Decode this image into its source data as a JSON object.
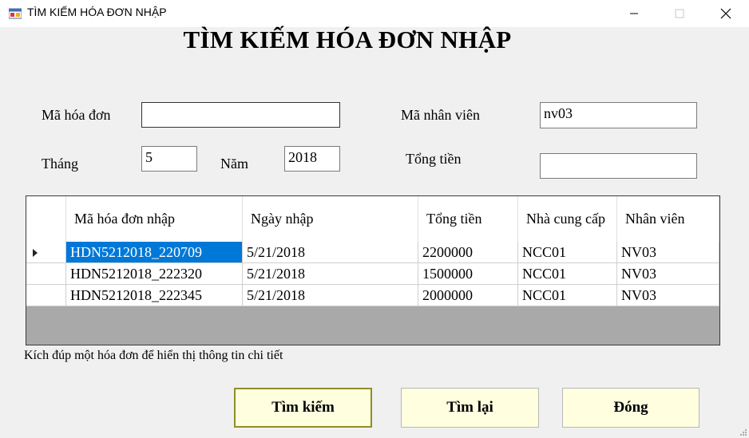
{
  "window": {
    "title": "TÌM KIẾM HÓA ĐƠN NHẬP",
    "minimize_icon": "minimize-icon",
    "maximize_icon": "maximize-icon",
    "close_icon": "close-icon"
  },
  "heading": "TÌM KIẾM HÓA ĐƠN NHẬP",
  "form": {
    "ma_hoa_don_label": "Mã hóa đơn",
    "ma_hoa_don_value": "",
    "ma_nhan_vien_label": "Mã nhân viên",
    "ma_nhan_vien_value": "nv03",
    "thang_label": "Tháng",
    "thang_value": "5",
    "nam_label": "Năm",
    "nam_value": "2018",
    "tong_tien_label": "Tổng tiền",
    "tong_tien_value": ""
  },
  "table": {
    "columns": [
      "Mã hóa đơn nhập",
      "Ngày nhập",
      "Tổng tiền",
      "Nhà cung cấp",
      "Nhân viên"
    ],
    "rows": [
      [
        "HDN5212018_220709",
        "5/21/2018",
        "2200000",
        "NCC01",
        "NV03"
      ],
      [
        "HDN5212018_222320",
        "5/21/2018",
        "1500000",
        "NCC01",
        "NV03"
      ],
      [
        "HDN5212018_222345",
        "5/21/2018",
        "2000000",
        "NCC01",
        "NV03"
      ]
    ],
    "selected_row": 0
  },
  "hint": "Kích đúp một hóa đơn để hiển thị thông tin chi tiết",
  "buttons": {
    "search": "Tìm kiếm",
    "reset": "Tìm lại",
    "close": "Đóng"
  }
}
